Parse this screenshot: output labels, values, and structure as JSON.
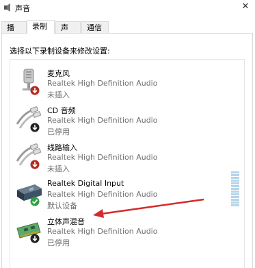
{
  "window": {
    "title": "声音",
    "close_glyph": "✕",
    "title_icon": "speaker-icon"
  },
  "tabs": [
    {
      "label": "播放",
      "active": false
    },
    {
      "label": "录制",
      "active": true
    },
    {
      "label": "声音",
      "active": false
    },
    {
      "label": "通信",
      "active": false
    }
  ],
  "instruction": "选择以下录制设备来修改设置:",
  "devices": [
    {
      "name": "麦克风",
      "description": "Realtek High Definition Audio",
      "status": "未插入",
      "icon": "microphone-icon",
      "badge": "red-down-arrow"
    },
    {
      "name": "CD 音频",
      "description": "Realtek High Definition Audio",
      "status": "已停用",
      "icon": "cd-audio-cable-icon",
      "badge": "black-down-arrow"
    },
    {
      "name": "线路输入",
      "description": "Realtek High Definition Audio",
      "status": "未插入",
      "icon": "line-in-cable-icon",
      "badge": "red-down-arrow"
    },
    {
      "name": "Realtek Digital Input",
      "description": "Realtek High Definition Audio",
      "status": "默认设备",
      "icon": "digital-input-icon",
      "badge": "green-check"
    },
    {
      "name": "立体声混音",
      "description": "Realtek High Definition Audio",
      "status": "已停用",
      "icon": "sound-card-icon",
      "badge": "black-down-arrow"
    }
  ],
  "colors": {
    "annotation_arrow": "#d42a2a",
    "check_badge": "#2ea043",
    "red_badge": "#c0392b"
  }
}
